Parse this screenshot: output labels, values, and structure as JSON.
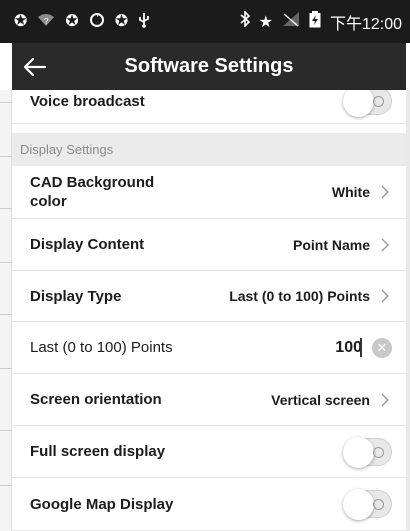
{
  "status_bar": {
    "time": "下午12:00",
    "left_icons": [
      "app-icon",
      "wifi-question-icon",
      "app-icon",
      "sync-icon",
      "app-icon",
      "usb-icon"
    ],
    "right_icons": [
      "bluetooth-icon",
      "star-icon",
      "signal-icon",
      "battery-icon"
    ]
  },
  "appbar": {
    "title": "Software Settings",
    "back_icon": "arrow-left-icon"
  },
  "rows": {
    "voice_broadcast": {
      "label": "Voice broadcast",
      "toggle_on": false
    },
    "section_display": "Display Settings",
    "cad_background": {
      "label_line1": "CAD Background",
      "label_line2": "color",
      "value": "White"
    },
    "display_content": {
      "label": "Display Content",
      "value": "Point Name"
    },
    "display_type": {
      "label": "Display Type",
      "value": "Last (0 to 100) Points"
    },
    "last_points": {
      "label": "Last (0 to 100) Points",
      "value": "100"
    },
    "screen_orientation": {
      "label": "Screen orientation",
      "value": "Vertical screen"
    },
    "full_screen": {
      "label": "Full screen display",
      "toggle_on": false
    },
    "google_map": {
      "label": "Google Map Display",
      "toggle_on": false
    }
  },
  "colors": {
    "status_bar_bg": "#1b1b1b",
    "appbar_bg": "#2a2a2a",
    "section_bg": "#ebebeb",
    "section_text": "#8a8a8a"
  }
}
